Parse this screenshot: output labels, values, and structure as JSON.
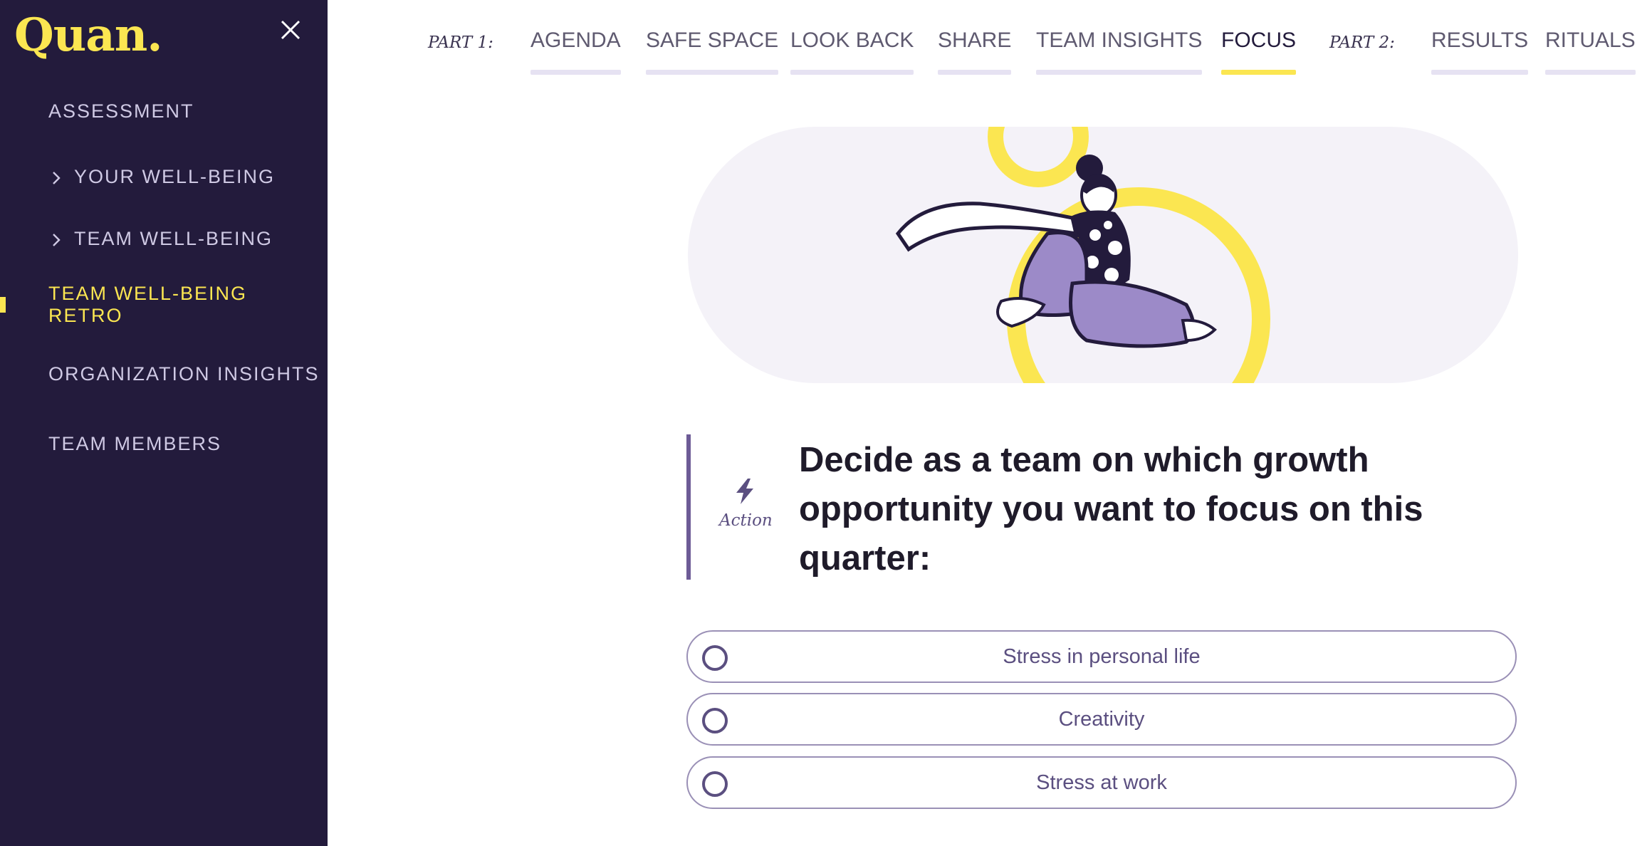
{
  "app": {
    "logo_text": "Quan."
  },
  "sidebar": {
    "items": [
      {
        "label": "ASSESSMENT"
      },
      {
        "label": "YOUR WELL-BEING"
      },
      {
        "label": "TEAM WELL-BEING"
      },
      {
        "label": "TEAM WELL-BEING RETRO"
      },
      {
        "label": "ORGANIZATION INSIGHTS"
      },
      {
        "label": "TEAM MEMBERS"
      }
    ],
    "active_item": "TEAM WELL-BEING RETRO"
  },
  "tabs": {
    "part1_label": "PART 1:",
    "part2_label": "PART 2:",
    "items": [
      {
        "label": "AGENDA"
      },
      {
        "label": "SAFE SPACE"
      },
      {
        "label": "LOOK BACK"
      },
      {
        "label": "SHARE"
      },
      {
        "label": "TEAM INSIGHTS"
      },
      {
        "label": "FOCUS"
      },
      {
        "label": "RESULTS"
      },
      {
        "label": "RITUALS"
      }
    ],
    "active_tab": "FOCUS"
  },
  "action": {
    "label": "Action",
    "question": "Decide as a team on which growth opportunity you want to focus on this quarter:"
  },
  "options": [
    {
      "label": "Stress in personal life"
    },
    {
      "label": "Creativity"
    },
    {
      "label": "Stress at work"
    }
  ],
  "colors": {
    "sidebar_bg": "#231b3c",
    "accent_yellow": "#fbe651",
    "accent_purple": "#5b4f80",
    "hero_bg": "#f4f2f8"
  }
}
